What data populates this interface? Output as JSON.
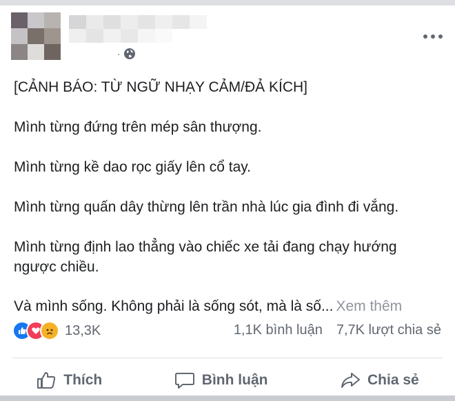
{
  "post": {
    "lines": [
      "[CẢNH BÁO: TỪ NGỮ NHẠY CẢM/ĐẢ KÍCH]",
      "Mình từng đứng trên mép sân thượng.",
      "Mình từng kề dao rọc giấy lên cổ tay.",
      "Mình từng quấn dây thừng lên trần nhà lúc gia đình đi vắng.",
      "Mình từng định lao thẳng vào chiếc xe tải đang chạy hướng ngược chiều.",
      "Và mình sống. Không phải là sống sót, mà là số..."
    ],
    "see_more": "Xem thêm",
    "meta_dot": "·",
    "privacy_icon": "globe-icon"
  },
  "engagement": {
    "reactions": [
      "like-icon",
      "love-icon",
      "sad-icon"
    ],
    "reaction_count": "13,3K",
    "comments": "1,1K bình luận",
    "shares": "7,7K lượt chia sẻ"
  },
  "actions": {
    "like": "Thích",
    "comment": "Bình luận",
    "share": "Chia sẻ"
  },
  "colors": {
    "like": "#1877f2",
    "love": "#f33e58",
    "sad": "#f7b125",
    "secondary_text": "#606770"
  }
}
